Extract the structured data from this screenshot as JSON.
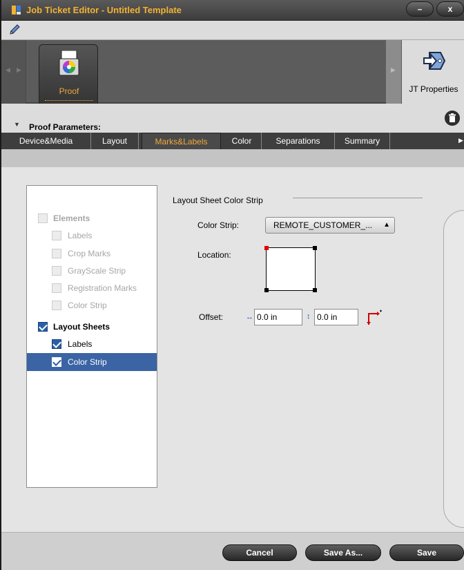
{
  "window": {
    "title": "Job Ticket Editor - Untitled Template",
    "min_glyph": "–",
    "close_glyph": "x"
  },
  "toolbar": {
    "proof_label": "Proof",
    "jt_properties_label": "JT Properties"
  },
  "section": {
    "title": "Proof Parameters:"
  },
  "tabs": [
    {
      "label": "Device&Media",
      "active": false
    },
    {
      "label": "Layout",
      "active": false
    },
    {
      "label": "Marks&Labels",
      "active": true
    },
    {
      "label": "Color",
      "active": false
    },
    {
      "label": "Separations",
      "active": false
    },
    {
      "label": "Summary",
      "active": false
    }
  ],
  "tree": {
    "items": [
      {
        "label": "Elements",
        "checked": false,
        "disabled": true,
        "bold": true,
        "indent": 0
      },
      {
        "label": "Labels",
        "checked": false,
        "disabled": true,
        "bold": false,
        "indent": 1
      },
      {
        "label": "Crop Marks",
        "checked": false,
        "disabled": true,
        "bold": false,
        "indent": 1
      },
      {
        "label": "GrayScale Strip",
        "checked": false,
        "disabled": true,
        "bold": false,
        "indent": 1
      },
      {
        "label": "Registration Marks",
        "checked": false,
        "disabled": true,
        "bold": false,
        "indent": 1
      },
      {
        "label": "Color Strip",
        "checked": false,
        "disabled": true,
        "bold": false,
        "indent": 1
      },
      {
        "label": "Layout Sheets",
        "checked": true,
        "disabled": false,
        "bold": true,
        "indent": 0
      },
      {
        "label": "Labels",
        "checked": true,
        "disabled": false,
        "bold": false,
        "indent": 1
      },
      {
        "label": "Color Strip",
        "checked": true,
        "disabled": false,
        "bold": false,
        "indent": 1,
        "selected": true
      }
    ]
  },
  "panel": {
    "title": "Layout Sheet Color Strip",
    "color_strip_label": "Color Strip:",
    "color_strip_value": "REMOTE_CUSTOMER_...",
    "location_label": "Location:",
    "offset_label": "Offset:",
    "offset_x": "0.0 in",
    "offset_y": "0.0 in"
  },
  "footer": {
    "cancel": "Cancel",
    "save_as": "Save As...",
    "save": "Save"
  },
  "colors": {
    "accent": "#f2a83a",
    "selection": "#3a64a4",
    "check": "#2a5fa8"
  }
}
